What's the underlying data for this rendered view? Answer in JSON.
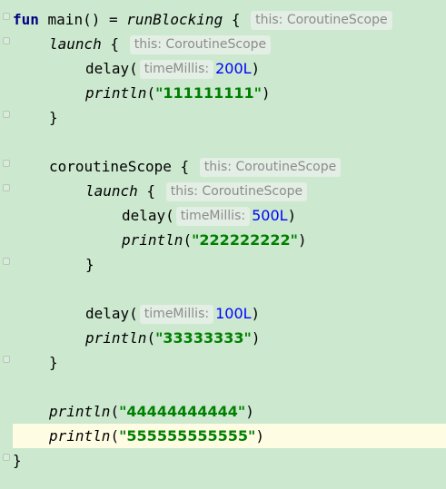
{
  "editor": {
    "colors": {
      "background": "#cce8cf",
      "current_line": "#fffce4",
      "keyword": "#000080",
      "string": "#008000",
      "number": "#0000ff",
      "hint_text": "#8c8c8c"
    },
    "code": {
      "fun_kw": "fun",
      "main_sig": " main() = ",
      "run_blocking": "runBlocking",
      "open_brace": " {",
      "close_brace": "}",
      "launch": "launch",
      "coroutine_scope": "coroutineScope",
      "delay": "delay(",
      "println": "println",
      "open_paren": "(",
      "close_paren": ")",
      "hint_this": "this: CoroutineScope",
      "hint_time": "timeMillis:",
      "delay_1_value": "200L",
      "delay_2_value": "500L",
      "delay_3_value": "100L",
      "string_1": "\"111111111\"",
      "string_2": "\"222222222\"",
      "string_3": "\"33333333\"",
      "string_4": "\"44444444444\"",
      "string_5": "\"555555555555\""
    }
  }
}
